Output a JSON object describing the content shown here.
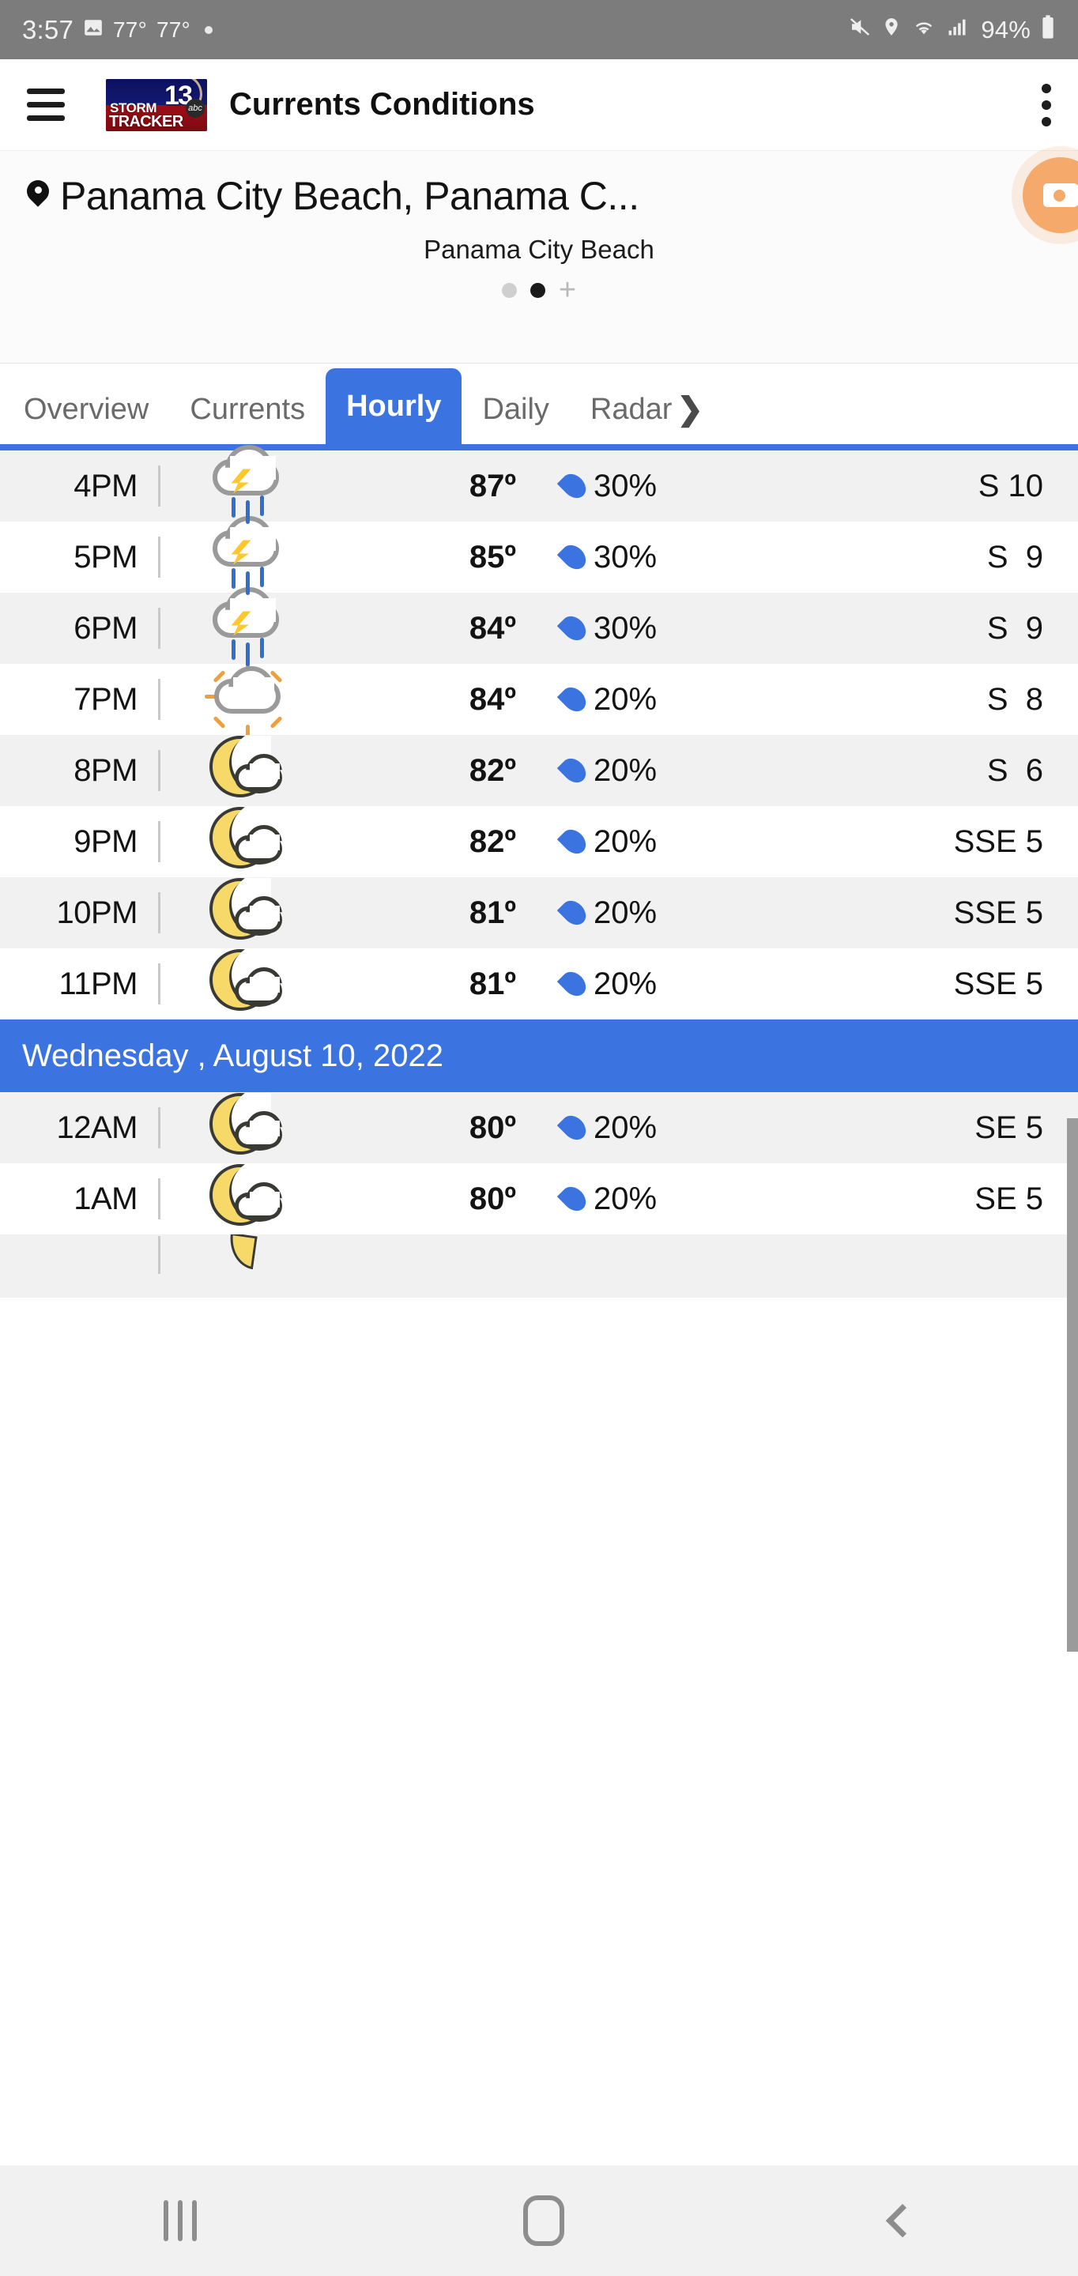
{
  "status_bar": {
    "time": "3:57",
    "image_icon": "image-icon",
    "temp1": "77°",
    "temp2": "77°",
    "dot": "•",
    "mute_icon": "mute-icon",
    "location_icon": "location-icon",
    "wifi_icon": "wifi-icon",
    "signal_icon": "signal-icon",
    "battery_percent": "94%",
    "battery_icon": "battery-icon"
  },
  "app_bar": {
    "menu_icon": "hamburger-menu-icon",
    "logo": {
      "storm": "STORM",
      "tracker": "TRACKER",
      "channel": "13",
      "network": "abc"
    },
    "title": "Currents Conditions",
    "overflow_icon": "kebab-menu-icon"
  },
  "location": {
    "pin_icon": "location-pin-icon",
    "name": "Panama City Beach, Panama C...",
    "sub_name": "Panama City Beach",
    "pager": {
      "dots": 2,
      "active_index": 1,
      "add_label": "+"
    },
    "fab_icon": "video-camera-icon"
  },
  "tabs": [
    {
      "label": "Overview",
      "active": false
    },
    {
      "label": "Currents",
      "active": false
    },
    {
      "label": "Hourly",
      "active": true
    },
    {
      "label": "Daily",
      "active": false
    },
    {
      "label": "Radar",
      "active": false,
      "chevron": "❯"
    }
  ],
  "colors": {
    "accent": "#3b74e0",
    "row_alt": "#f1f1f1",
    "rain_drop": "#3b74e0",
    "lightning": "#ffc72e",
    "moon": "#f7d96a",
    "status_bar": "#7c7c7c",
    "fab": "#f5a96b"
  },
  "hourly": [
    {
      "time": "4PM",
      "icon": "thunderstorm-icon",
      "temp": "87º",
      "pop": "30%",
      "wind": "S 10"
    },
    {
      "time": "5PM",
      "icon": "thunderstorm-icon",
      "temp": "85º",
      "pop": "30%",
      "wind": "S  9"
    },
    {
      "time": "6PM",
      "icon": "thunderstorm-icon",
      "temp": "84º",
      "pop": "30%",
      "wind": "S  9"
    },
    {
      "time": "7PM",
      "icon": "partly-cloudy-day-icon",
      "temp": "84º",
      "pop": "20%",
      "wind": "S  8"
    },
    {
      "time": "8PM",
      "icon": "partly-cloudy-night-icon",
      "temp": "82º",
      "pop": "20%",
      "wind": "S  6"
    },
    {
      "time": "9PM",
      "icon": "partly-cloudy-night-icon",
      "temp": "82º",
      "pop": "20%",
      "wind": "SSE 5"
    },
    {
      "time": "10PM",
      "icon": "partly-cloudy-night-icon",
      "temp": "81º",
      "pop": "20%",
      "wind": "SSE 5"
    },
    {
      "time": "11PM",
      "icon": "partly-cloudy-night-icon",
      "temp": "81º",
      "pop": "20%",
      "wind": "SSE 5"
    }
  ],
  "date_separator": "Wednesday , August 10, 2022",
  "hourly_next_day": [
    {
      "time": "12AM",
      "icon": "partly-cloudy-night-icon",
      "temp": "80º",
      "pop": "20%",
      "wind": "SE 5"
    },
    {
      "time": "1AM",
      "icon": "partly-cloudy-night-icon",
      "temp": "80º",
      "pop": "20%",
      "wind": "SE 5"
    }
  ],
  "nav_bar": {
    "recents_icon": "recents-icon",
    "home_icon": "home-icon",
    "back_icon": "back-icon"
  }
}
